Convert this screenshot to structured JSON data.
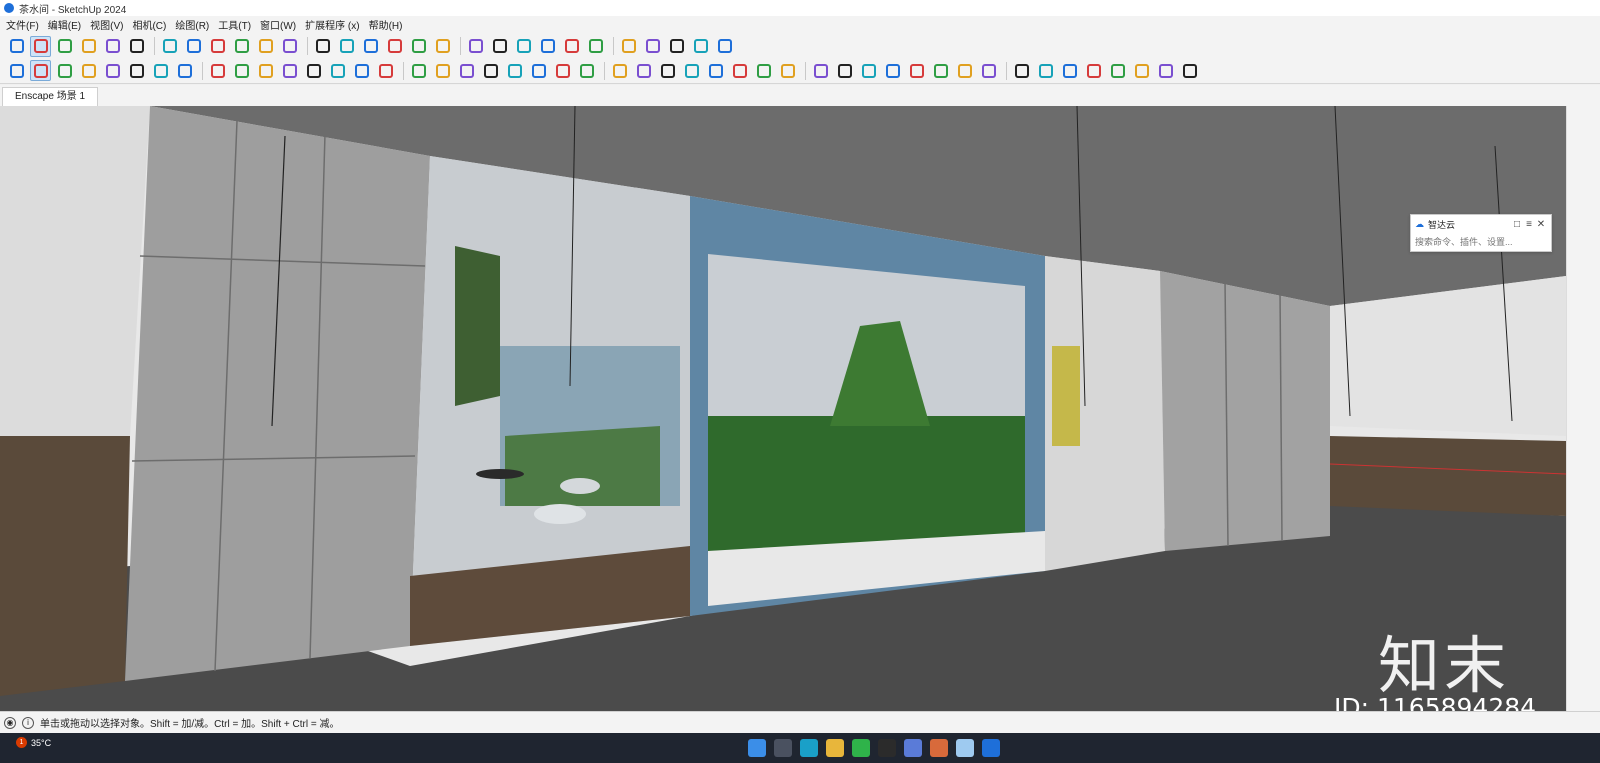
{
  "window": {
    "title": "茶水间 - SketchUp 2024"
  },
  "menu": [
    "文件(F)",
    "编辑(E)",
    "视图(V)",
    "相机(C)",
    "绘图(R)",
    "工具(T)",
    "窗口(W)",
    "扩展程序 (x)",
    "帮助(H)"
  ],
  "toolbar1": [
    "zoom",
    "select",
    "eraser",
    "pencil",
    "line",
    "rectangle",
    "push-pull",
    "follow-me",
    "move",
    "rotate",
    "scale",
    "offset",
    "tape",
    "protractor",
    "section",
    "orbit",
    "pan",
    "zoom-window",
    "zoom-extents",
    "warehouse",
    "extension-warehouse",
    "layout",
    "profile",
    "document",
    "user",
    "sandbox",
    "tag",
    "help",
    "settings"
  ],
  "toolbar2": [
    "paint",
    "components",
    "groups",
    "add",
    "shield",
    "checker",
    "cloud",
    "gear",
    "folder",
    "info",
    "cart",
    "account",
    "enscape",
    "render",
    "video",
    "camera",
    "vr",
    "sync",
    "asset",
    "box",
    "wave",
    "cloud2",
    "cloud3",
    "cloud4",
    "settings2",
    "check",
    "download",
    "gear2",
    "split",
    "sun",
    "cone",
    "line",
    "frame",
    "eye",
    "ruler",
    "pipe",
    "stair",
    "brush",
    "bench",
    "panel",
    "sofa",
    "bed",
    "cross",
    "curve",
    "flag",
    "flag2",
    "stairs",
    "slope"
  ],
  "tabs": [
    "Enscape 场景 1"
  ],
  "panel": {
    "title": "智达云",
    "placeholder": "搜索命令、插件、设置..."
  },
  "status": {
    "text": "单击或拖动以选择对象。Shift = 加/减。Ctrl = 加。Shift + Ctrl = 减。"
  },
  "taskbar": {
    "weather": "35°C",
    "badge": "1"
  },
  "watermark": {
    "logo": "知末",
    "id": "ID: 1165894284"
  },
  "colors": {
    "frame_blue": "#5f86a4",
    "wall_gray": "#9a9a9a",
    "floor_dark": "#4a4a4a",
    "ceiling": "#6e6e6e",
    "plant_green": "#2e6b2a"
  }
}
